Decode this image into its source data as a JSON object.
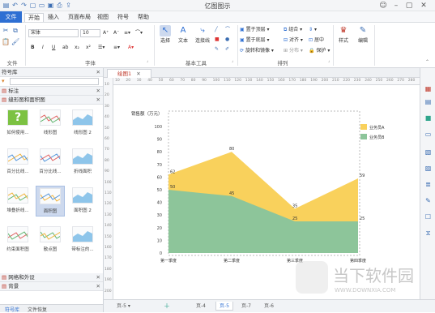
{
  "app": {
    "title": "亿图图示",
    "accent": "#2e6fd3"
  },
  "menu": {
    "file": "文件",
    "tabs": [
      "开始",
      "插入",
      "页面布局",
      "视图",
      "符号",
      "帮助"
    ],
    "active_index": 0
  },
  "ribbon": {
    "font_name": "宋体",
    "font_size": "10",
    "groups": {
      "file": "文件",
      "font": "字体",
      "basic_tools": "基本工具",
      "arrange": "排列"
    },
    "tools": {
      "select": "选择",
      "text": "文本",
      "connector": "连接线"
    },
    "arrange": {
      "bring_front": "置于顶层",
      "send_back": "置于底层",
      "rotate": "旋转和镜像",
      "group": "组合",
      "align": "对齐",
      "distribute": "分布",
      "center": "居中",
      "protect": "保护"
    },
    "style": "样式",
    "edit": "编辑"
  },
  "library": {
    "title": "符号库",
    "category_marker": "标注",
    "category_open": "缝形图和面积图",
    "items": [
      {
        "name": "如何使用...",
        "icon": "help-icon"
      },
      {
        "name": "线形图"
      },
      {
        "name": "线形图 2"
      },
      {
        "name": "百分比线..."
      },
      {
        "name": "百分比线..."
      },
      {
        "name": "折线面积"
      },
      {
        "name": "堆叠折线..."
      },
      {
        "name": "面积图",
        "selected": true
      },
      {
        "name": "面积图 2"
      },
      {
        "name": "约束面积图"
      },
      {
        "name": "散点图"
      },
      {
        "name": "带标注的..."
      }
    ],
    "category_2": "网格和外设",
    "category_3": "背景",
    "footer_tabs": [
      "符号库",
      "文件恢复"
    ]
  },
  "document": {
    "tab_label": "绘图1",
    "ruler_ticks": [
      "10",
      "20",
      "30",
      "40",
      "50",
      "60",
      "70",
      "80",
      "90",
      "100",
      "110",
      "120",
      "130",
      "140",
      "150",
      "160",
      "170",
      "180",
      "190",
      "200",
      "210",
      "220",
      "230",
      "240",
      "250",
      "260",
      "270",
      "280"
    ]
  },
  "chart_data": {
    "type": "area",
    "ylabel": "销售额（万元）",
    "categories": [
      "第一季度",
      "第二季度",
      "第三季度",
      "第四季度"
    ],
    "ylim": [
      0,
      100
    ],
    "yticks": [
      0,
      10,
      20,
      30,
      40,
      50,
      60,
      70,
      80,
      90,
      100
    ],
    "stacked": true,
    "series": [
      {
        "name": "业务员B",
        "values": [
          50,
          45,
          25,
          25
        ],
        "color": "#8dc59a"
      },
      {
        "name": "业务员A",
        "values": [
          62,
          80,
          35,
          59
        ],
        "color": "#f9d15c"
      }
    ],
    "data_labels": [
      {
        "series": "业务员A",
        "values": [
          62,
          80,
          35,
          59
        ]
      },
      {
        "series": "业务员B",
        "values": [
          50,
          45,
          25,
          25
        ]
      }
    ],
    "legend_position": "top-right",
    "grid": false
  },
  "pages": {
    "current": "页-5",
    "tabs": [
      "页-4",
      "页-5",
      "页-7",
      "页-6"
    ],
    "active": "页-5"
  },
  "status": {
    "brand": "当下软件园",
    "url": "WWW.DOWNXIA.COM"
  }
}
